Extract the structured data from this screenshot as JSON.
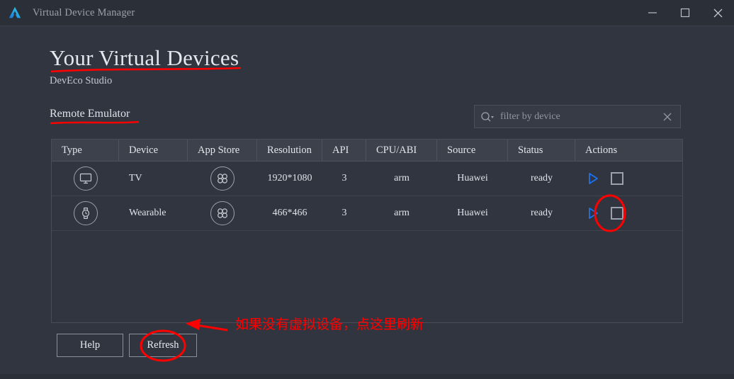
{
  "window": {
    "title": "Virtual Device Manager",
    "logo_icon": "deveco-triangle-logo",
    "controls": {
      "minimize": "minimize-icon",
      "maximize": "maximize-icon",
      "close": "close-icon"
    }
  },
  "header": {
    "page_title": "Your Virtual Devices",
    "subtitle": "DevEco Studio",
    "tab": "Remote Emulator"
  },
  "search": {
    "placeholder": "filter by device",
    "value": "",
    "search_icon": "search-dropdown-icon",
    "clear_icon": "clear-icon"
  },
  "table": {
    "columns": [
      "Type",
      "Device",
      "App Store",
      "Resolution",
      "API",
      "CPU/ABI",
      "Source",
      "Status",
      "Actions"
    ],
    "rows": [
      {
        "type_icon": "tv-icon",
        "device": "TV",
        "app_store_icon": "app-gallery-icon",
        "resolution": "1920*1080",
        "api": "3",
        "cpu_abi": "arm",
        "source": "Huawei",
        "status": "ready",
        "actions": {
          "play": "play-icon",
          "stop": "stop-icon"
        }
      },
      {
        "type_icon": "watch-icon",
        "device": "Wearable",
        "app_store_icon": "app-gallery-icon",
        "resolution": "466*466",
        "api": "3",
        "cpu_abi": "arm",
        "source": "Huawei",
        "status": "ready",
        "actions": {
          "play": "play-icon",
          "stop": "stop-icon"
        }
      }
    ]
  },
  "footer": {
    "help_label": "Help",
    "refresh_label": "Refresh"
  },
  "annotations": {
    "note_text": "如果没有虚拟设备，点这里刷新",
    "color": "#ff0000",
    "marks": [
      "underline-page-title",
      "underline-remote-emulator",
      "ellipse-wearable-play-button",
      "ellipse-refresh-button",
      "arrow-to-refresh-button"
    ]
  },
  "colors": {
    "background": "#31353f",
    "titlebar": "#2b2f38",
    "table_header": "#3c414b",
    "border": "#484d57",
    "text_primary": "#e2e6ec",
    "text_muted": "#9aa1ac",
    "accent_blue": "#1a73f0",
    "annotation_red": "#ff0000"
  }
}
